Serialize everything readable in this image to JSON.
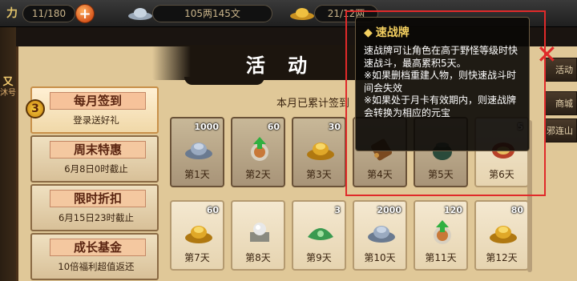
{
  "topbar": {
    "left_glyph": "力",
    "count": "11/180",
    "plus": "+",
    "money": "105两145文",
    "gold": "21/12两"
  },
  "left_strip": {
    "line1": "又",
    "line2": "沐号"
  },
  "right_tabs": [
    "活动",
    "商城",
    "邪连山"
  ],
  "title": "活 动",
  "menu": [
    {
      "title": "每月签到",
      "sub": "登录送好礼",
      "active": true
    },
    {
      "title": "周末特惠",
      "sub": "6月8日0时截止",
      "active": false
    },
    {
      "title": "限时折扣",
      "sub": "6月15日23时截止",
      "active": false
    },
    {
      "title": "成长基金",
      "sub": "10倍福利超值返还",
      "active": false
    }
  ],
  "menu_arrow": "3",
  "cumulative_text": "本月已累计签到",
  "rewards": [
    {
      "day": "第1天",
      "qty": "1000",
      "icon": "silver-ingot-icon",
      "shade": "dark"
    },
    {
      "day": "第2天",
      "qty": "60",
      "icon": "exp-bun-icon",
      "shade": "dark"
    },
    {
      "day": "第3天",
      "qty": "30",
      "icon": "gold-ingot-icon",
      "shade": "dark"
    },
    {
      "day": "第4天",
      "qty": "",
      "icon": "scroll-icon",
      "shade": "dark"
    },
    {
      "day": "第5天",
      "qty": "",
      "icon": "pot-icon",
      "shade": "dark"
    },
    {
      "day": "第6天",
      "qty": "5",
      "icon": "speed-card-icon",
      "shade": "light"
    },
    {
      "day": "第7天",
      "qty": "60",
      "icon": "gold-ingot-icon",
      "shade": "light"
    },
    {
      "day": "第8天",
      "qty": "",
      "icon": "pearl-box-icon",
      "shade": "light"
    },
    {
      "day": "第9天",
      "qty": "3",
      "icon": "jade-leaf-icon",
      "shade": "light"
    },
    {
      "day": "第10天",
      "qty": "2000",
      "icon": "silver-ingot-icon",
      "shade": "light"
    },
    {
      "day": "第11天",
      "qty": "120",
      "icon": "exp-bun-icon",
      "shade": "light"
    },
    {
      "day": "第12天",
      "qty": "80",
      "icon": "gold-ingot-icon",
      "shade": "light"
    }
  ],
  "tooltip": {
    "diamond": "◆",
    "title": "速战牌",
    "body": "速战牌可让角色在高于野怪等级时快速战斗，最高累积5天。\n※如果删档重建人物，则快速战斗时间会失效\n※如果处于月卡有效期内，则速战牌会转换为相应的元宝",
    "close": "✕"
  },
  "colors": {
    "highlight_border": "#e02a2a",
    "tooltip_title": "#f4d060"
  }
}
